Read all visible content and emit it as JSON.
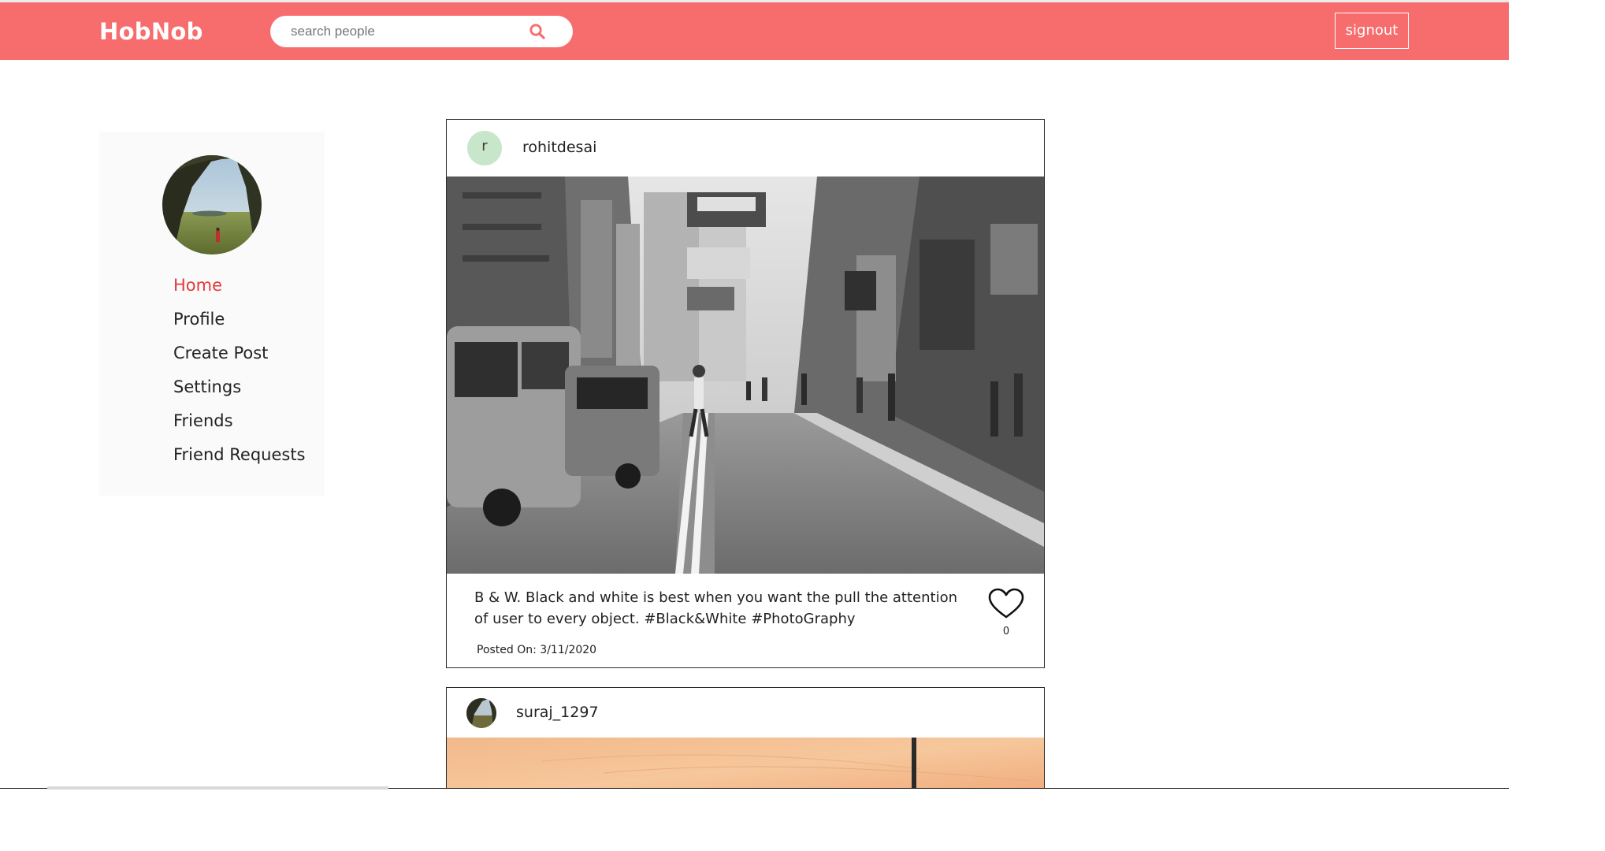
{
  "header": {
    "logo": "HobNob",
    "search": {
      "placeholder": "search people",
      "value": ""
    },
    "signout_label": "signout",
    "accent_color": "#f76d6d"
  },
  "sidebar": {
    "nav": [
      {
        "label": "Home",
        "active": true
      },
      {
        "label": "Profile",
        "active": false
      },
      {
        "label": "Create Post",
        "active": false
      },
      {
        "label": "Settings",
        "active": false
      },
      {
        "label": "Friends",
        "active": false
      },
      {
        "label": "Friend Requests",
        "active": false
      }
    ],
    "active_color": "#e23a3a"
  },
  "feed": {
    "posts": [
      {
        "avatar_initial": "r",
        "username": "rohitdesai",
        "caption": "B & W. Black and white is best when you want the pull the attention of user to every object. #Black&White #PhotoGraphy",
        "posted_on": "Posted On: 3/11/2020",
        "likes": "0",
        "like_icon": "heart-outline-icon"
      },
      {
        "username": "suraj_1297"
      }
    ]
  }
}
